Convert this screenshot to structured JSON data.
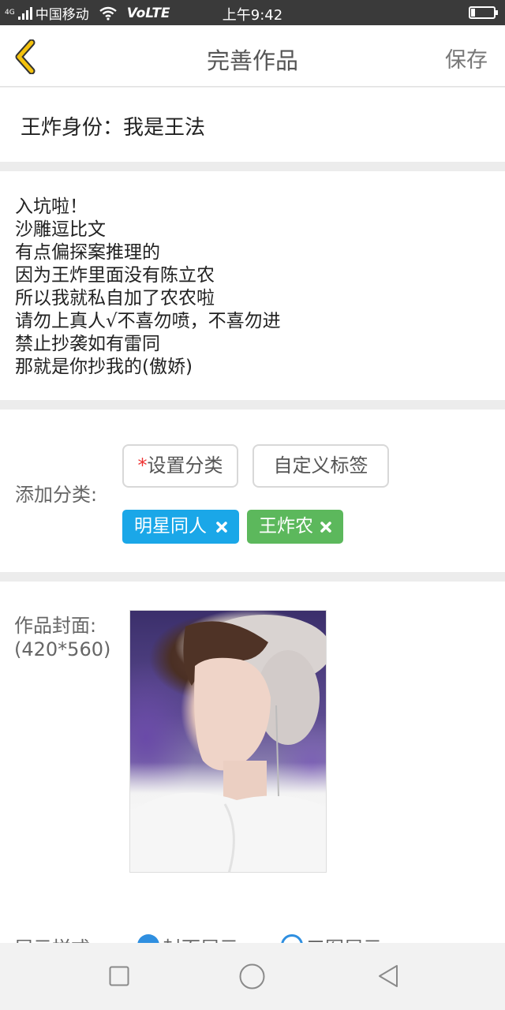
{
  "status_bar": {
    "network": "4G",
    "carrier": "中国移动",
    "volte": "VoLTE",
    "time": "上午9:42"
  },
  "nav": {
    "title": "完善作品",
    "save_label": "保存"
  },
  "work": {
    "title": "王炸身份：我是王法",
    "description_lines": [
      "入坑啦！",
      "沙雕逗比文",
      "有点偏探案推理的",
      "因为王炸里面没有陈立农",
      "所以我就私自加了农农啦",
      "请勿上真人√不喜勿喷，不喜勿进",
      "禁止抄袭如有雷同",
      "那就是你抄我的(傲娇)"
    ]
  },
  "category": {
    "label": "添加分类:",
    "required_mark": "*",
    "set_category_label": "设置分类",
    "custom_tag_label": "自定义标签",
    "tags": [
      {
        "label": "明星同人",
        "color": "#1aa7e8",
        "remove_icon": "close-icon"
      },
      {
        "label": "王炸农",
        "color": "#5cb85c",
        "remove_icon": "close-icon"
      }
    ]
  },
  "cover": {
    "label": "作品封面:",
    "size_hint": "(420*560)"
  },
  "display_style": {
    "label": "展示样式:",
    "options": [
      {
        "label": "封面展示",
        "selected": true
      },
      {
        "label": "三图展示",
        "selected": false
      }
    ]
  },
  "colors": {
    "accent_yellow": "#f4c20d",
    "radio_blue": "#2f8fe0"
  }
}
